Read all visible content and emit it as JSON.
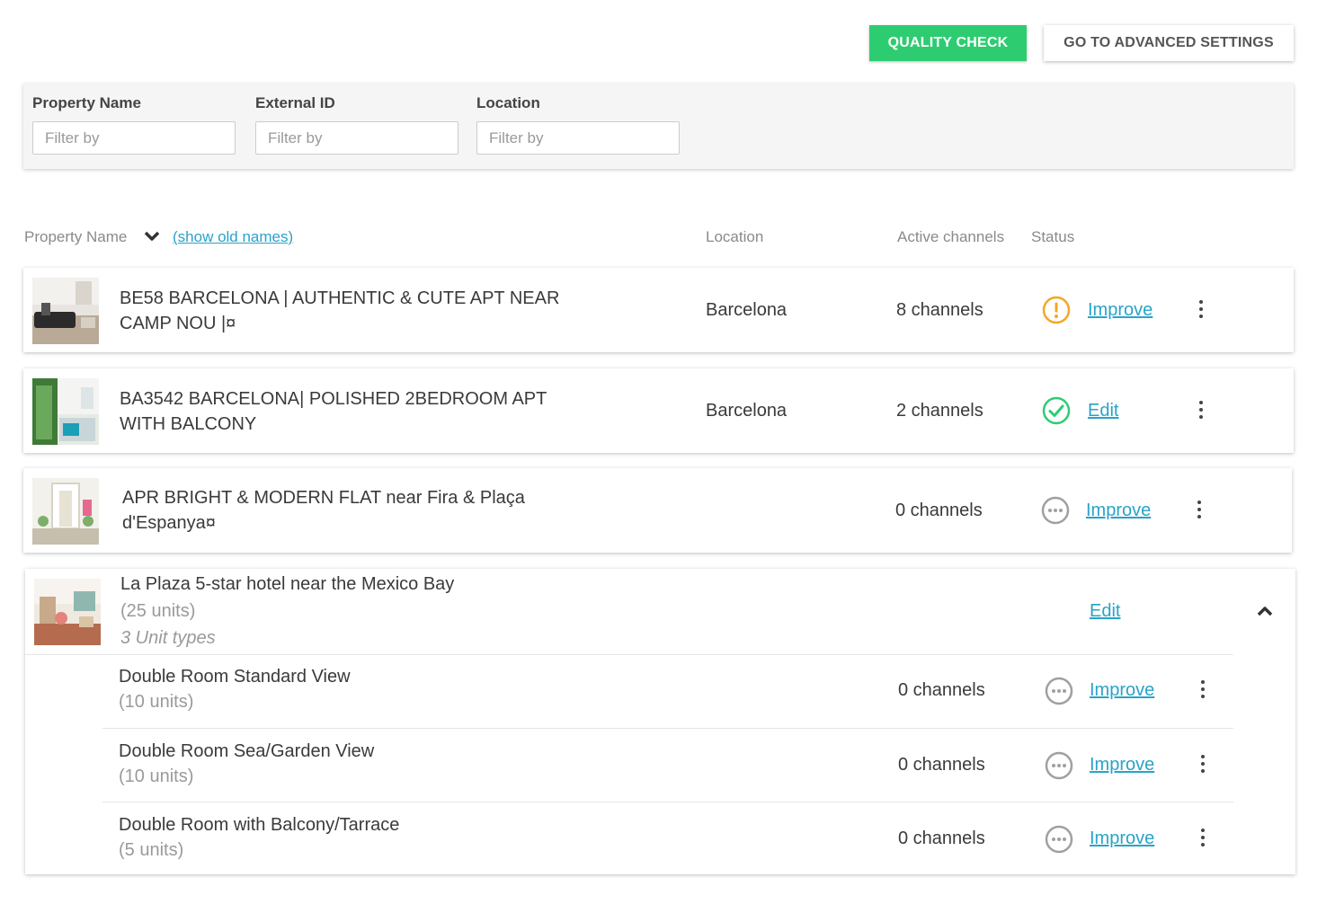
{
  "toolbar": {
    "quality_check": "QUALITY CHECK",
    "advanced_settings": "GO TO ADVANCED SETTINGS"
  },
  "filters": [
    {
      "label": "Property Name",
      "placeholder": "Filter by"
    },
    {
      "label": "External ID",
      "placeholder": "Filter by"
    },
    {
      "label": "Location",
      "placeholder": "Filter by"
    }
  ],
  "table": {
    "headers": {
      "property_name": "Property Name",
      "show_old_names": "(show old names)",
      "location": "Location",
      "active_channels": "Active channels",
      "status": "Status"
    }
  },
  "properties": [
    {
      "name_line1": "BE58 BARCELONA | AUTHENTIC & CUTE APT NEAR",
      "name_line2": "CAMP NOU |¤",
      "location": "Barcelona",
      "channels": "8 channels",
      "status": "warning",
      "action": "Improve"
    },
    {
      "name_line1": "BA3542 BARCELONA| POLISHED 2BEDROOM APT",
      "name_line2": "WITH BALCONY",
      "location": "Barcelona",
      "channels": "2 channels",
      "status": "ok",
      "action": "Edit"
    },
    {
      "name_line1": "APR BRIGHT & MODERN FLAT near Fira & Plaça",
      "name_line2": "d'Espanya¤",
      "location": "",
      "channels": "0 channels",
      "status": "pending",
      "action": "Improve"
    }
  ],
  "hotel": {
    "name": "La Plaza 5-star hotel near the Mexico Bay",
    "units": "(25 units)",
    "unit_types": "3 Unit types",
    "action": "Edit",
    "rooms": [
      {
        "name": "Double Room Standard View",
        "units": "(10 units)",
        "channels": "0 channels",
        "status": "pending",
        "action": "Improve"
      },
      {
        "name": "Double Room Sea/Garden View",
        "units": "(10 units)",
        "channels": "0 channels",
        "status": "pending",
        "action": "Improve"
      },
      {
        "name": "Double Room with Balcony/Tarrace",
        "units": "(5 units)",
        "channels": "0 channels",
        "status": "pending",
        "action": "Improve"
      }
    ]
  },
  "colors": {
    "accent_green": "#2ecc71",
    "link_blue": "#29a3c8",
    "warning_orange": "#f5a623",
    "ok_green": "#2ecc71",
    "pending_grey": "#a0a0a0"
  }
}
